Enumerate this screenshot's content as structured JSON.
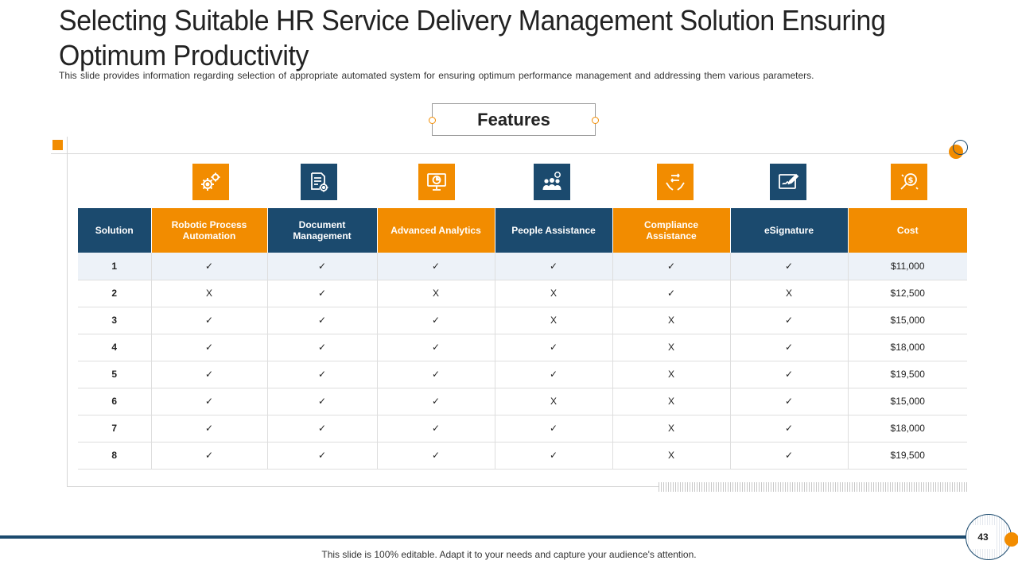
{
  "slide": {
    "title": "Selecting Suitable HR Service Delivery Management Solution Ensuring Optimum Productivity",
    "subtitle": "This slide provides information regarding selection of appropriate automated system for ensuring optimum performance management and addressing them various parameters.",
    "features_label": "Features",
    "footer_text": "This slide is 100% editable. Adapt it to your needs and capture your audience's attention.",
    "page_number": "43"
  },
  "colors": {
    "navy": "#1b4a6e",
    "orange": "#f28c00",
    "highlight_row": "#edf2f8"
  },
  "icons": [
    "gears-icon",
    "document-gear-icon",
    "analytics-monitor-icon",
    "people-group-icon",
    "hands-compliance-icon",
    "esignature-icon",
    "cost-search-icon"
  ],
  "table": {
    "headers": [
      "Solution",
      "Robotic Process Automation",
      "Document Management",
      "Advanced Analytics",
      "People Assistance",
      "Compliance Assistance",
      "eSignature",
      "Cost"
    ],
    "rows": [
      [
        "1",
        "✓",
        "✓",
        "✓",
        "✓",
        "✓",
        "✓",
        "$11,000"
      ],
      [
        "2",
        "X",
        "✓",
        "X",
        "X",
        "✓",
        "X",
        "$12,500"
      ],
      [
        "3",
        "✓",
        "✓",
        "✓",
        "X",
        "X",
        "✓",
        "$15,000"
      ],
      [
        "4",
        "✓",
        "✓",
        "✓",
        "✓",
        "X",
        "✓",
        "$18,000"
      ],
      [
        "5",
        "✓",
        "✓",
        "✓",
        "✓",
        "X",
        "✓",
        "$19,500"
      ],
      [
        "6",
        "✓",
        "✓",
        "✓",
        "X",
        "X",
        "✓",
        "$15,000"
      ],
      [
        "7",
        "✓",
        "✓",
        "✓",
        "✓",
        "X",
        "✓",
        "$18,000"
      ],
      [
        "8",
        "✓",
        "✓",
        "✓",
        "✓",
        "X",
        "✓",
        "$19,500"
      ]
    ]
  }
}
